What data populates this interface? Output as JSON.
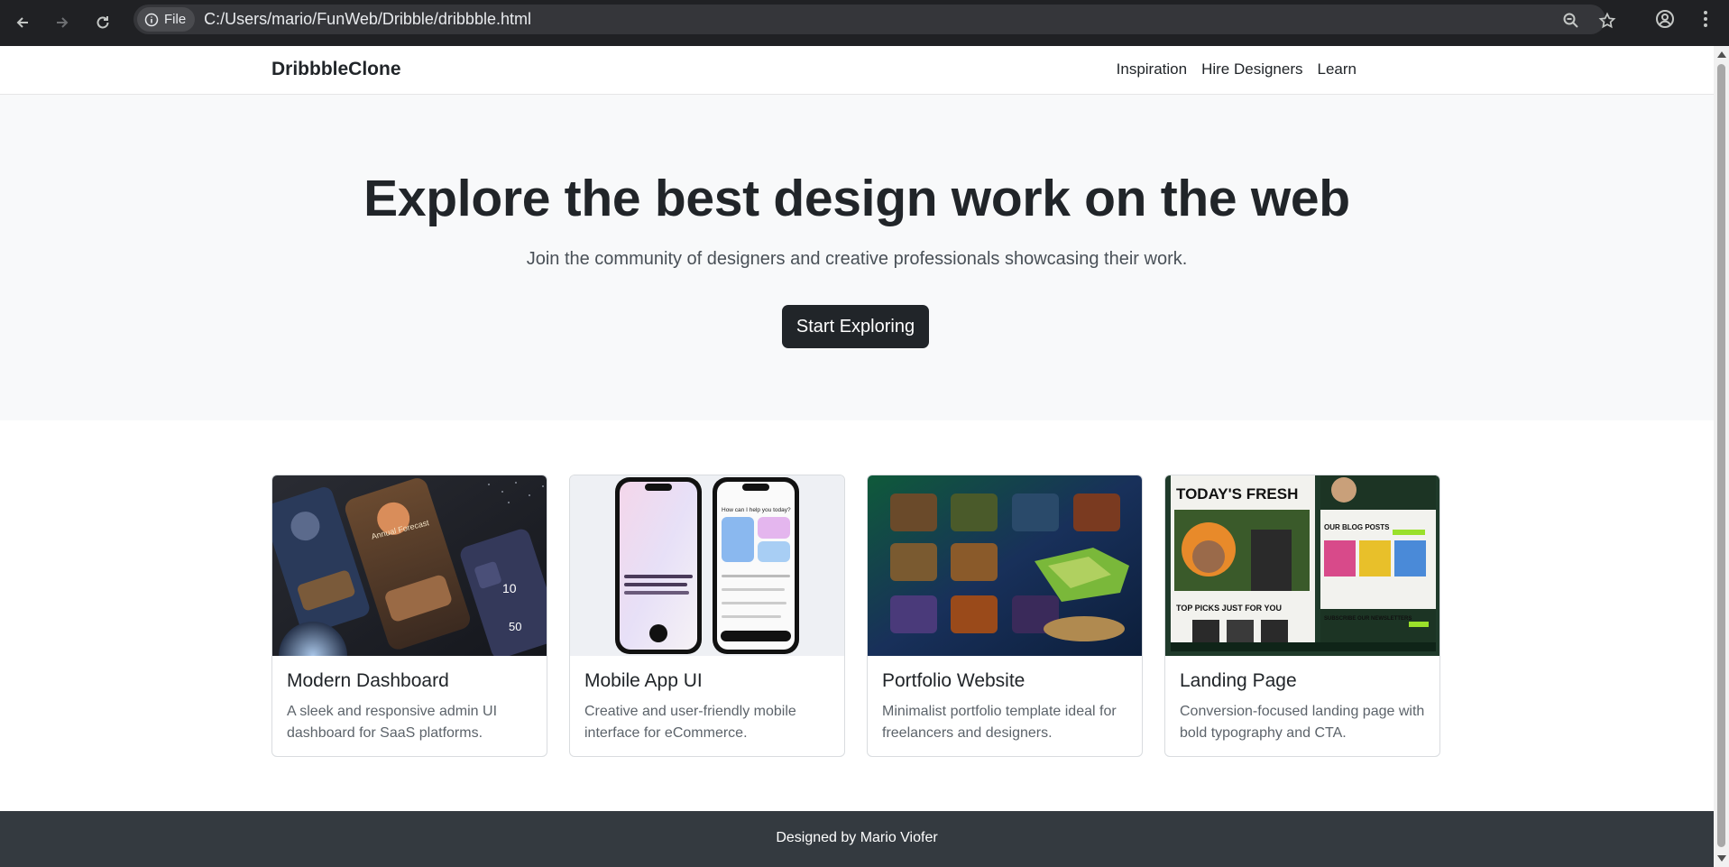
{
  "browser": {
    "file_label": "File",
    "url": "C:/Users/mario/FunWeb/Dribble/dribbble.html"
  },
  "navbar": {
    "brand": "DribbbleClone",
    "links": [
      "Inspiration",
      "Hire Designers",
      "Learn"
    ]
  },
  "hero": {
    "title": "Explore the best design work on the web",
    "subtitle": "Join the community of designers and creative professionals showcasing their work.",
    "button": "Start Exploring"
  },
  "cards": [
    {
      "title": "Modern Dashboard",
      "text": "A sleek and responsive admin UI dashboard for SaaS platforms.",
      "image_words": [
        "Annual Forecast",
        "10",
        "50"
      ]
    },
    {
      "title": "Mobile App UI",
      "text": "Creative and user-friendly mobile interface for eCommerce.",
      "image_words": [
        "How can I help you today?"
      ]
    },
    {
      "title": "Portfolio Website",
      "text": "Minimalist portfolio template ideal for freelancers and designers."
    },
    {
      "title": "Landing Page",
      "text": "Conversion-focused landing page with bold typography and CTA.",
      "image_words": [
        "TODAY'S FRESH",
        "OUR BLOG POSTS",
        "TOP PICKS JUST FOR YOU",
        "SUBSCRIBE OUR NEWSLETTERS"
      ]
    }
  ],
  "footer": {
    "text": "Designed by Mario Viofer"
  },
  "colors": {
    "chrome": "#202124",
    "hero_bg": "#f8f9fa",
    "dark": "#212529",
    "footer_bg": "#343a40"
  }
}
